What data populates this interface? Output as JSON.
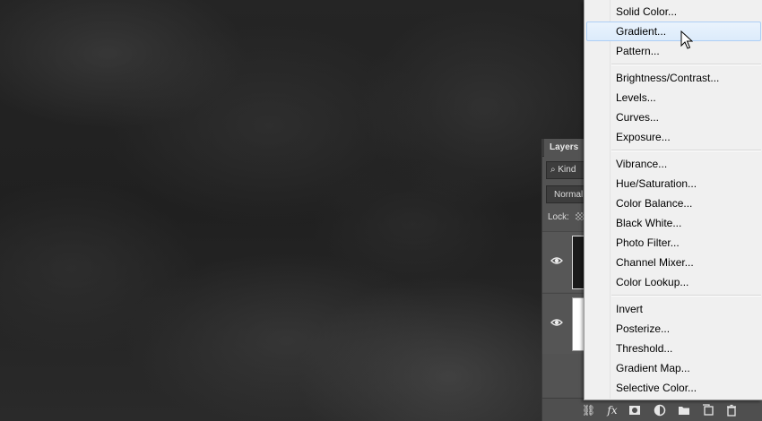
{
  "layers_panel": {
    "tab_label": "Layers",
    "kind_label": "Kind",
    "blend_mode": "Normal",
    "lock_label": "Lock:"
  },
  "adjustment_menu": {
    "groups": [
      [
        "Solid Color...",
        "Gradient...",
        "Pattern..."
      ],
      [
        "Brightness/Contrast...",
        "Levels...",
        "Curves...",
        "Exposure..."
      ],
      [
        "Vibrance...",
        "Hue/Saturation...",
        "Color Balance...",
        "Black  White...",
        "Photo Filter...",
        "Channel Mixer...",
        "Color Lookup..."
      ],
      [
        "Invert",
        "Posterize...",
        "Threshold...",
        "Gradient Map...",
        "Selective Color..."
      ]
    ],
    "hovered_item": "Gradient..."
  },
  "footer_icons": [
    "link-icon",
    "fx-icon",
    "mask-icon",
    "adjustment-icon",
    "folder-icon",
    "new-layer-icon",
    "trash-icon"
  ],
  "colors": {
    "menu_bg": "#f0f0f0",
    "highlight": "#dcebfb",
    "panel_bg": "#535353"
  }
}
